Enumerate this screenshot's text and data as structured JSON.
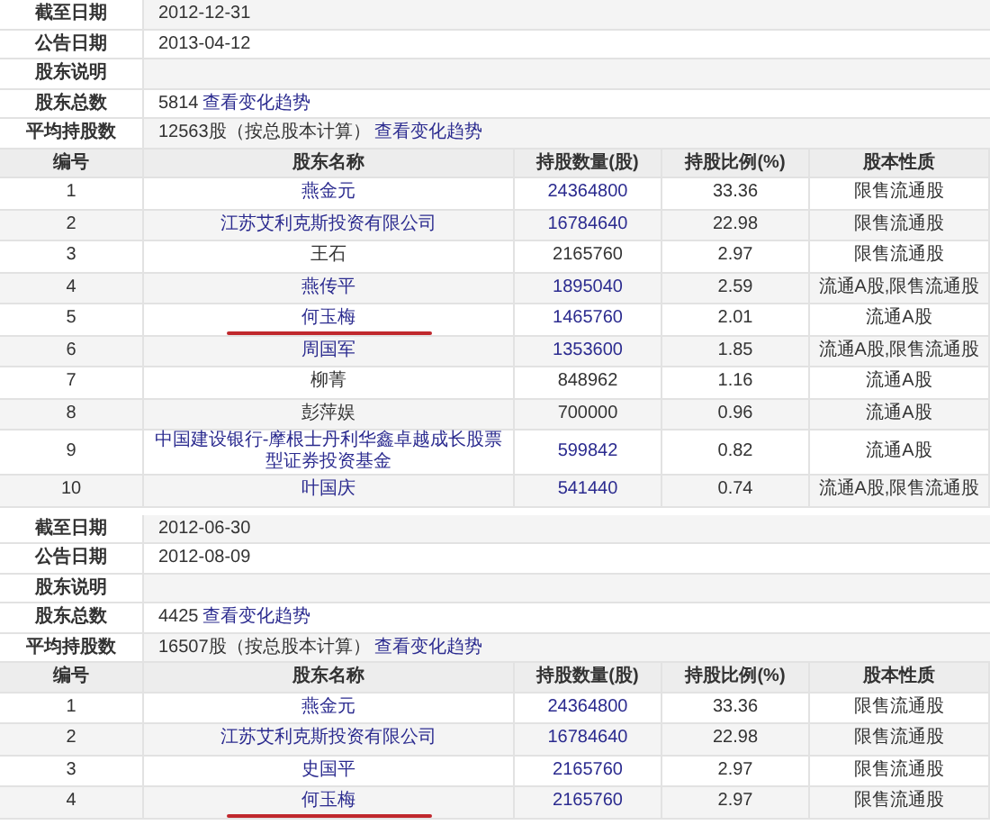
{
  "sections": [
    {
      "info": [
        {
          "label": "截至日期",
          "value": "2012-12-31"
        },
        {
          "label": "公告日期",
          "value": "2013-04-12"
        },
        {
          "label": "股东说明"
        },
        {
          "label": "股东总数",
          "value": "5814",
          "link": "查看变化趋势"
        },
        {
          "label": "平均持股数",
          "value": "12563股（按总股本计算）",
          "link": "查看变化趋势"
        }
      ],
      "columns": [
        "编号",
        "股东名称",
        "持股数量(股)",
        "持股比例(%)",
        "股本性质"
      ],
      "rows": [
        {
          "no": "1",
          "name": "燕金元",
          "link": true,
          "shares": "24364800",
          "ratio": "33.36",
          "nature": "限售流通股",
          "marked": false
        },
        {
          "no": "2",
          "name": "江苏艾利克斯投资有限公司",
          "link": true,
          "shares": "16784640",
          "ratio": "22.98",
          "nature": "限售流通股",
          "marked": false
        },
        {
          "no": "3",
          "name": "王石",
          "link": false,
          "shares": "2165760",
          "ratio": "2.97",
          "nature": "限售流通股",
          "marked": false
        },
        {
          "no": "4",
          "name": "燕传平",
          "link": true,
          "shares": "1895040",
          "ratio": "2.59",
          "nature": "流通A股,限售流通股",
          "marked": false
        },
        {
          "no": "5",
          "name": "何玉梅",
          "link": true,
          "shares": "1465760",
          "ratio": "2.01",
          "nature": "流通A股",
          "marked": true
        },
        {
          "no": "6",
          "name": "周国军",
          "link": true,
          "shares": "1353600",
          "ratio": "1.85",
          "nature": "流通A股,限售流通股",
          "marked": false
        },
        {
          "no": "7",
          "name": "柳菁",
          "link": false,
          "shares": "848962",
          "ratio": "1.16",
          "nature": "流通A股",
          "marked": false
        },
        {
          "no": "8",
          "name": "彭萍娱",
          "link": false,
          "shares": "700000",
          "ratio": "0.96",
          "nature": "流通A股",
          "marked": false
        },
        {
          "no": "9",
          "name": "中国建设银行-摩根士丹利华鑫卓越成长股票型证券投资基金",
          "link": true,
          "shares": "599842",
          "ratio": "0.82",
          "nature": "流通A股",
          "marked": false
        },
        {
          "no": "10",
          "name": "叶国庆",
          "link": true,
          "shares": "541440",
          "ratio": "0.74",
          "nature": "流通A股,限售流通股",
          "marked": false
        }
      ]
    },
    {
      "info": [
        {
          "label": "截至日期",
          "value": "2012-06-30"
        },
        {
          "label": "公告日期",
          "value": "2012-08-09"
        },
        {
          "label": "股东说明"
        },
        {
          "label": "股东总数",
          "value": "4425",
          "link": "查看变化趋势"
        },
        {
          "label": "平均持股数",
          "value": "16507股（按总股本计算）",
          "link": "查看变化趋势"
        }
      ],
      "columns": [
        "编号",
        "股东名称",
        "持股数量(股)",
        "持股比例(%)",
        "股本性质"
      ],
      "rows": [
        {
          "no": "1",
          "name": "燕金元",
          "link": true,
          "shares": "24364800",
          "ratio": "33.36",
          "nature": "限售流通股",
          "marked": false
        },
        {
          "no": "2",
          "name": "江苏艾利克斯投资有限公司",
          "link": true,
          "shares": "16784640",
          "ratio": "22.98",
          "nature": "限售流通股",
          "marked": false
        },
        {
          "no": "3",
          "name": "史国平",
          "link": true,
          "shares": "2165760",
          "ratio": "2.97",
          "nature": "限售流通股",
          "marked": false
        },
        {
          "no": "4",
          "name": "何玉梅",
          "link": true,
          "shares": "2165760",
          "ratio": "2.97",
          "nature": "限售流通股",
          "marked": true
        }
      ]
    }
  ]
}
